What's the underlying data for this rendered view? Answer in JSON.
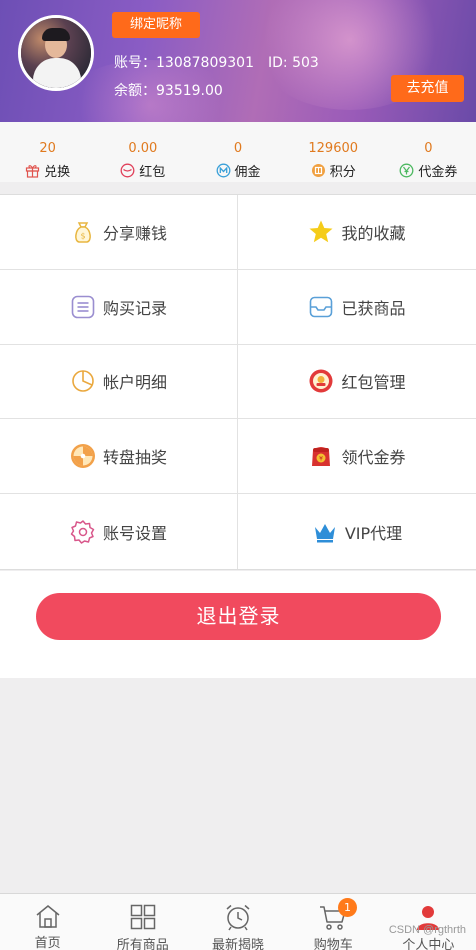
{
  "header": {
    "bind_nickname_label": "绑定昵称",
    "account_label": "账号：",
    "account_value": "13087809301",
    "id_label": "ID:",
    "id_value": "503",
    "balance_label": "余额：",
    "balance_value": "93519.00",
    "recharge_label": "去充值"
  },
  "stats": [
    {
      "value": "20",
      "label": "兑换",
      "icon": "gift-icon"
    },
    {
      "value": "0.00",
      "label": "红包",
      "icon": "red-packet-icon"
    },
    {
      "value": "0",
      "label": "佣金",
      "icon": "commission-icon"
    },
    {
      "value": "129600",
      "label": "积分",
      "icon": "points-icon"
    },
    {
      "value": "0",
      "label": "代金券",
      "icon": "voucher-icon"
    }
  ],
  "menu": [
    {
      "label": "分享赚钱",
      "icon": "money-bag-icon"
    },
    {
      "label": "我的收藏",
      "icon": "star-icon"
    },
    {
      "label": "购买记录",
      "icon": "list-icon"
    },
    {
      "label": "已获商品",
      "icon": "inbox-icon"
    },
    {
      "label": "帐户明细",
      "icon": "pie-chart-icon"
    },
    {
      "label": "红包管理",
      "icon": "red-packet-icon"
    },
    {
      "label": "转盘抽奖",
      "icon": "wheel-icon"
    },
    {
      "label": "领代金券",
      "icon": "coupon-icon"
    },
    {
      "label": "账号设置",
      "icon": "gear-icon"
    },
    {
      "label": "VIP代理",
      "icon": "crown-icon"
    }
  ],
  "logout_label": "退出登录",
  "tabs": [
    {
      "label": "首页",
      "icon": "home-icon"
    },
    {
      "label": "所有商品",
      "icon": "grid-icon"
    },
    {
      "label": "最新揭晓",
      "icon": "alarm-clock-icon"
    },
    {
      "label": "购物车",
      "icon": "cart-icon"
    },
    {
      "label": "个人中心",
      "icon": "user-icon"
    }
  ],
  "cart_badge": "1",
  "watermark": "CSDN @rgthrth",
  "colors": {
    "accent_orange": "#ff6a1a",
    "stat_value": "#e07a1f",
    "logout_red": "#f14a5e"
  }
}
